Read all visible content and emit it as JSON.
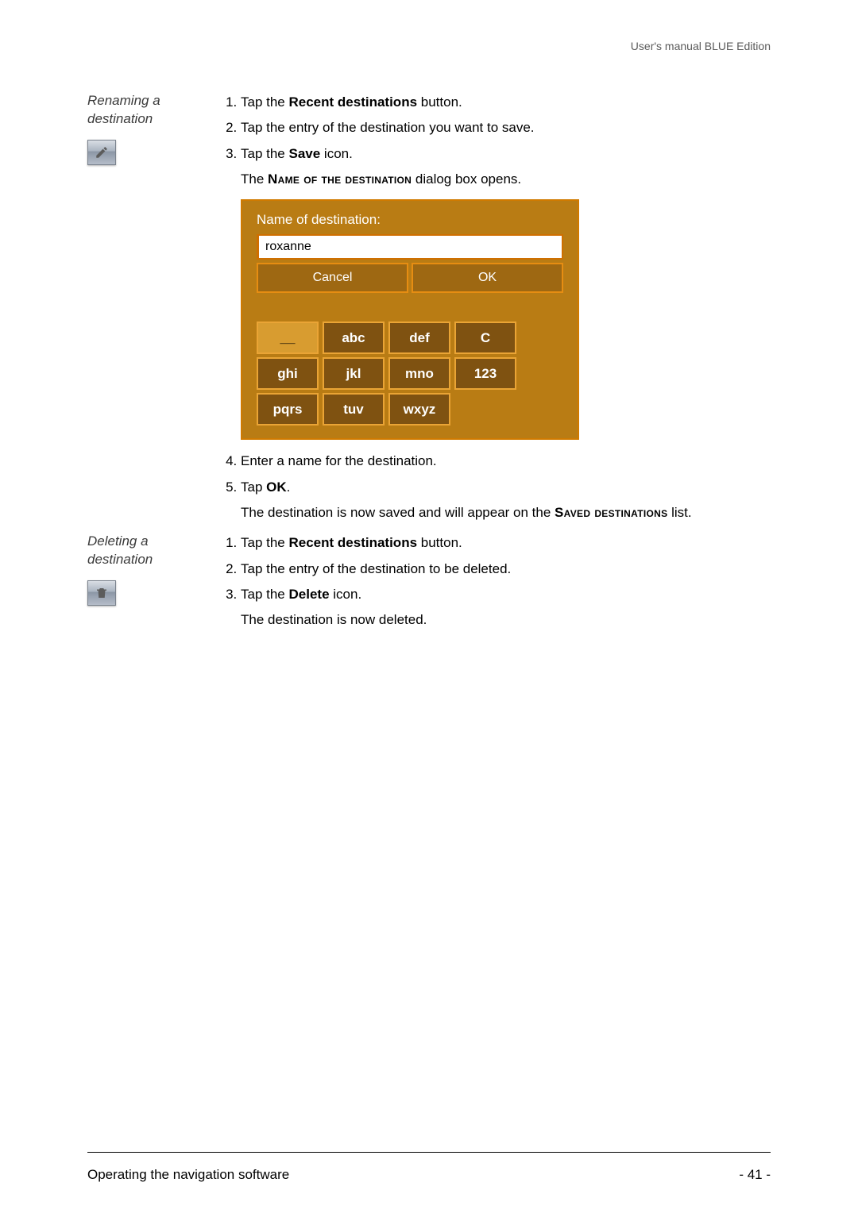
{
  "header": {
    "right": "User's manual BLUE Edition"
  },
  "section_rename": {
    "margin_label_1": "Renaming a",
    "margin_label_2": "destination",
    "steps": {
      "s1a": "Tap the ",
      "s1b": "Recent destinations",
      "s1c": " button.",
      "s2": "Tap the entry of the destination you want to save.",
      "s3a": "Tap the ",
      "s3b": "Save",
      "s3c": " icon.",
      "sub3a": "The ",
      "sub3b": "Name of the destination",
      "sub3c": " dialog box opens.",
      "s4": "Enter a name for the destination.",
      "s5a": "Tap ",
      "s5b": "OK",
      "s5c": ".",
      "sub5a": "The destination is now saved and will appear on the ",
      "sub5b": "Saved destinations",
      "sub5c": " list."
    }
  },
  "section_delete": {
    "margin_label_1": "Deleting a",
    "margin_label_2": "destination",
    "steps": {
      "s1a": "Tap the ",
      "s1b": "Recent destinations",
      "s1c": " button.",
      "s2": "Tap the entry of the destination to be deleted.",
      "s3a": "Tap the ",
      "s3b": "Delete",
      "s3c": " icon.",
      "sub3": "The destination is now deleted."
    }
  },
  "dialog": {
    "title": "Name of destination:",
    "input_value": "roxanne",
    "cancel": "Cancel",
    "ok": "OK",
    "keys": {
      "underscore": "__",
      "abc": "abc",
      "def": "def",
      "c": "C",
      "ghi": "ghi",
      "jkl": "jkl",
      "mno": "mno",
      "n123": "123",
      "pqrs": "pqrs",
      "tuv": "tuv",
      "wxyz": "wxyz"
    }
  },
  "footer": {
    "left": "Operating the navigation software",
    "right": "- 41 -"
  }
}
